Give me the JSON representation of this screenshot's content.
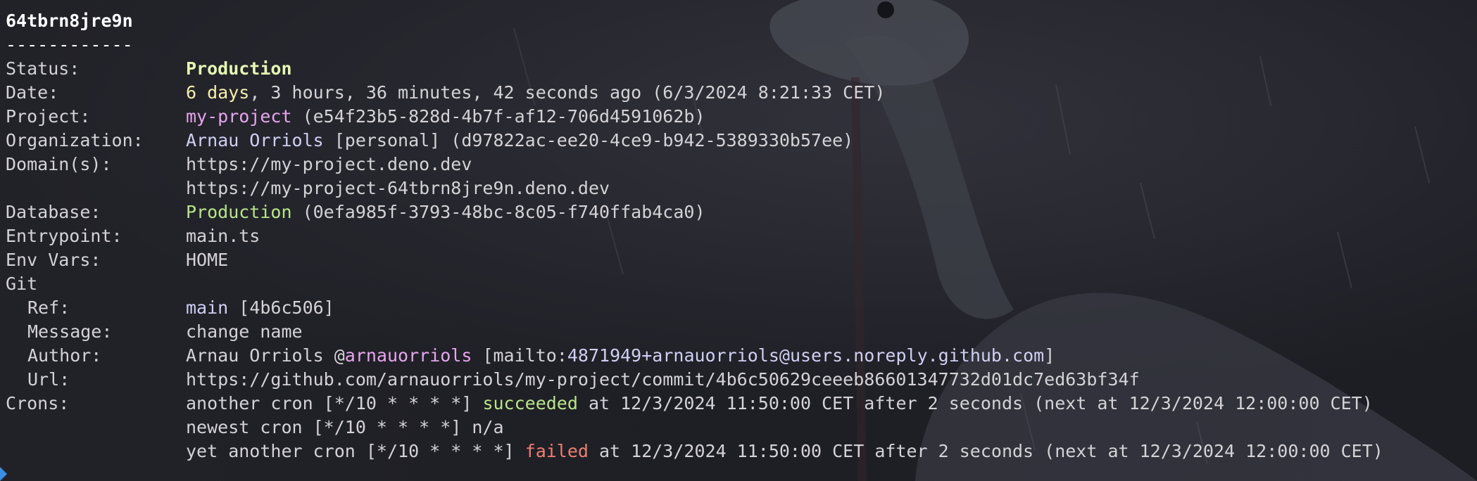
{
  "deployment": {
    "id": "64tbrn8jre9n",
    "separator": "------------"
  },
  "labels": {
    "status": "Status:",
    "date": "Date:",
    "project": "Project:",
    "organization": "Organization:",
    "domains": "Domain(s):",
    "database": "Database:",
    "entrypoint": "Entrypoint:",
    "env_vars": "Env Vars:",
    "git": "Git",
    "ref": "Ref:",
    "message": "Message:",
    "author": "Author:",
    "url": "Url:",
    "crons": "Crons:"
  },
  "status": "Production",
  "date": {
    "age_highlight": "6 days",
    "rest": ", 3 hours, 36 minutes, 42 seconds ago (6/3/2024 8:21:33 CET)"
  },
  "project": {
    "name": "my-project",
    "id_text": " (e54f23b5-828d-4b7f-af12-706d4591062b)"
  },
  "organization": {
    "name": "Arnau Orriols",
    "rest": " [personal] (d97822ac-ee20-4ce9-b942-5389330b57ee)"
  },
  "domains": [
    "https://my-project.deno.dev",
    "https://my-project-64tbrn8jre9n.deno.dev"
  ],
  "database": {
    "name": "Production",
    "id_text": " (0efa985f-3793-48bc-8c05-f740ffab4ca0)"
  },
  "entrypoint": "main.ts",
  "env_vars": "HOME",
  "git": {
    "ref_name": "main",
    "ref_hash": " [4b6c506]",
    "message": "change name",
    "author_name": "Arnau Orriols @",
    "author_handle": "arnauorriols",
    "author_mail_open": " [mailto:",
    "author_mail": "4871949+arnauorriols@users.noreply.github.com",
    "author_mail_close": "]",
    "url": "https://github.com/arnauorriols/my-project/commit/4b6c50629ceeeb86601347732d01dc7ed63bf34f"
  },
  "crons": [
    {
      "prefix": "another cron [*/10 * * * *] ",
      "status": "succeeded",
      "suffix": " at 12/3/2024 11:50:00 CET after 2 seconds (next at 12/3/2024 12:00:00 CET)"
    },
    {
      "prefix": "newest cron [*/10 * * * *] n/a",
      "status": "",
      "suffix": ""
    },
    {
      "prefix": "yet another cron [*/10 * * * *] ",
      "status": "failed",
      "suffix": " at 12/3/2024 11:50:00 CET after 2 seconds (next at 12/3/2024 12:00:00 CET)"
    }
  ],
  "colors": {
    "background": "#24252c",
    "text": "#d4d2d6",
    "status_production": "#e6f7b3",
    "age": "#f5f0ae",
    "project_name": "#e7a5ee",
    "highlight": "#cfcff3",
    "database_name": "#b8e58a",
    "cron_succeeded": "#b8e58a",
    "cron_failed": "#ee7e72"
  }
}
